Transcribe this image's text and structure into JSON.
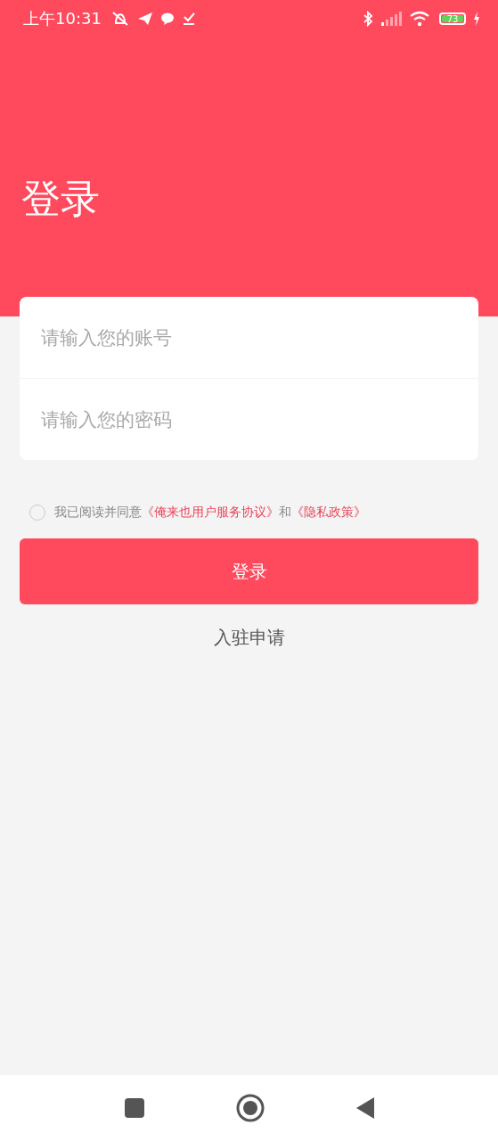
{
  "status_bar": {
    "time": "上午10:31",
    "battery": "73"
  },
  "header": {
    "title": "登录"
  },
  "fields": [
    {
      "placeholder": "请输入您的账号"
    },
    {
      "placeholder": "请输入您的密码"
    }
  ],
  "agreement": {
    "checked": false,
    "text": "我已阅读并同意",
    "links": [
      "《俺来也用户服务协议》",
      "《隐私政策》"
    ],
    "joiner": "和"
  },
  "login_button": "登录",
  "apply_link": "入驻申请"
}
